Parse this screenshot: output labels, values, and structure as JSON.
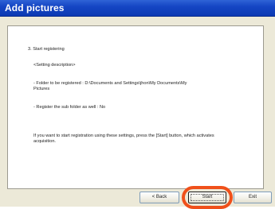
{
  "window": {
    "title": "Add pictures"
  },
  "content": {
    "step_heading": "3. Start registering",
    "setting_description": "<Setting description>",
    "folder_line": "- Folder to be registered :  D:\\Documents and Settings\\jhon\\My Documents\\My Pictures",
    "subfolder_line": "- Register the sub folder as well :  No",
    "instruction": "If you want to start registration using these settings, press the [Start] button, which activates acquisition."
  },
  "buttons": {
    "back_label": "< Back",
    "start_label": "Start",
    "exit_label": "Exit"
  },
  "colors": {
    "titlebar": "#1546c4",
    "highlight": "#f0501a",
    "dialog_bg": "#ece9d8"
  }
}
